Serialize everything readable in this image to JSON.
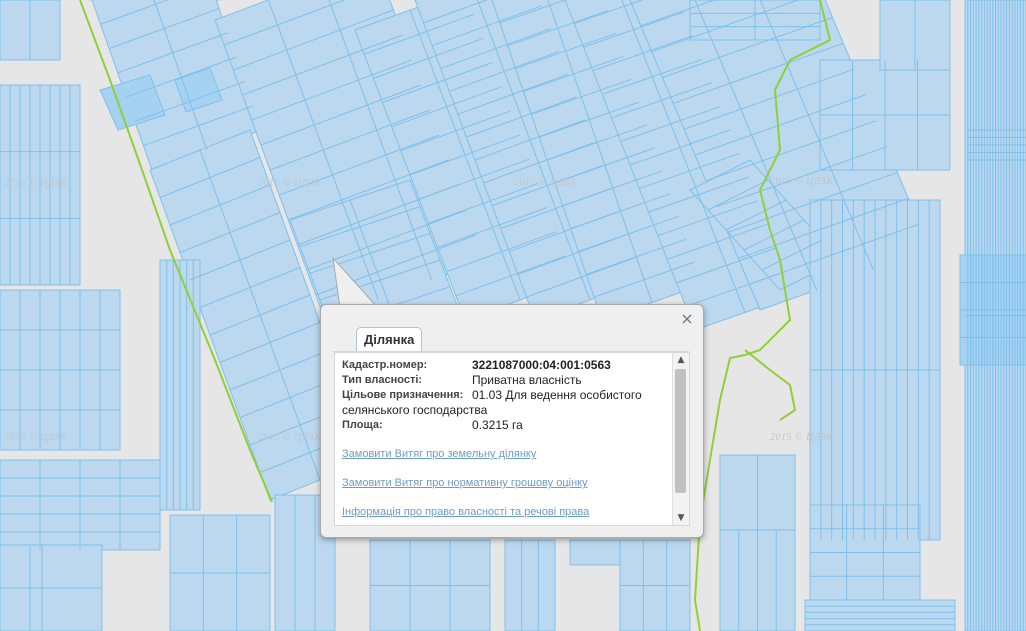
{
  "watermark": "2015 © ЦДЗК",
  "popup": {
    "tab_label": "Ділянка",
    "close_icon": "close-icon",
    "rows": [
      {
        "label": "Кадастр.номер:",
        "value": "3221087000:04:001:0563"
      },
      {
        "label": "Тип власності:",
        "value": "Приватна власність"
      },
      {
        "label": "Цільове призначення:",
        "value": "01.03 Для ведення особистого селянського господарства"
      },
      {
        "label": "Площа:",
        "value": "0.3215 га"
      }
    ],
    "links": [
      "Замовити Витяг про земельну ділянку",
      "Замовити Витяг про нормативну грошову оцінку",
      "Інформація про право власності та речові права"
    ]
  },
  "colors": {
    "background": "#e6e6e6",
    "parcel_fill": "#bcd8ee",
    "parcel_stroke": "#7ec0ec",
    "parcel_selected": "#a6d2f2",
    "boundary": "#8fd03a",
    "road": "#d9d9d9",
    "link": "#6f9cc4"
  }
}
